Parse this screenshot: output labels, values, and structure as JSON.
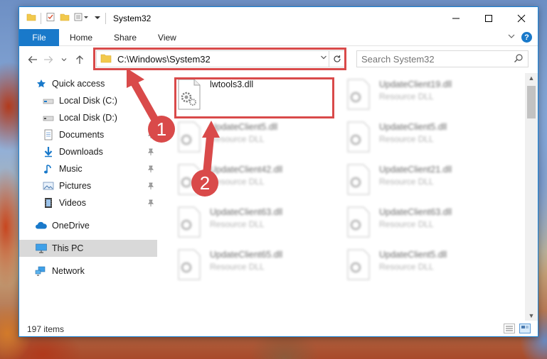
{
  "window": {
    "title": "System32"
  },
  "ribbon": {
    "tabs": [
      "File",
      "Home",
      "Share",
      "View"
    ]
  },
  "address": {
    "path": "C:\\Windows\\System32"
  },
  "search": {
    "placeholder": "Search System32"
  },
  "sidebar": {
    "items": [
      {
        "label": "Quick access",
        "icon": "star-icon"
      },
      {
        "label": "Local Disk (C:)",
        "icon": "drive-icon"
      },
      {
        "label": "Local Disk (D:)",
        "icon": "drive-icon"
      },
      {
        "label": "Documents",
        "icon": "documents-icon"
      },
      {
        "label": "Downloads",
        "icon": "download-icon"
      },
      {
        "label": "Music",
        "icon": "music-icon"
      },
      {
        "label": "Pictures",
        "icon": "pictures-icon"
      },
      {
        "label": "Videos",
        "icon": "videos-icon"
      },
      {
        "label": "OneDrive",
        "icon": "cloud-icon"
      },
      {
        "label": "This PC",
        "icon": "computer-icon"
      },
      {
        "label": "Network",
        "icon": "network-icon"
      }
    ]
  },
  "files": [
    {
      "name": "lwtools3.dll",
      "type": ""
    },
    {
      "name": "UpdateClient19.dll",
      "type": "Resource DLL"
    },
    {
      "name": "UpdateClient5.dll",
      "type": "Resource DLL"
    },
    {
      "name": "UpdateClient5.dll",
      "type": "Resource DLL"
    },
    {
      "name": "UpdateClient42.dll",
      "type": "Resource DLL"
    },
    {
      "name": "UpdateClient21.dll",
      "type": "Resource DLL"
    },
    {
      "name": "UpdateClient63.dll",
      "type": "Resource DLL"
    },
    {
      "name": "UpdateClient63.dll",
      "type": "Resource DLL"
    },
    {
      "name": "UpdateClient65.dll",
      "type": "Resource DLL"
    },
    {
      "name": "UpdateClient5.dll",
      "type": "Resource DLL"
    }
  ],
  "status": {
    "item_count": "197 items"
  },
  "annotations": {
    "step1": "1",
    "step2": "2"
  },
  "colors": {
    "accent": "#1979ca",
    "annotation": "#d94a4a",
    "selected": "#d9d9d9"
  }
}
